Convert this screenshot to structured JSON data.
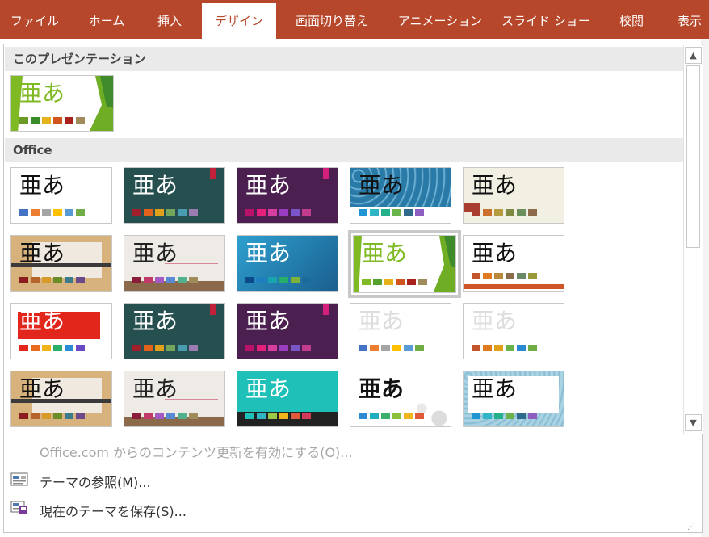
{
  "ribbon": {
    "tabs": [
      {
        "label": "ファイル"
      },
      {
        "label": "ホーム"
      },
      {
        "label": "挿入"
      },
      {
        "label": "デザイン"
      },
      {
        "label": "画面切り替え"
      },
      {
        "label": "アニメーション"
      },
      {
        "label": "スライド ショー"
      },
      {
        "label": "校閲"
      },
      {
        "label": "表示"
      }
    ],
    "active_tab": "デザイン",
    "bar_color": "#b7472a"
  },
  "gallery": {
    "section_this": "このプレゼンテーション",
    "section_office": "Office",
    "current_theme": {
      "text": "亜あ",
      "text_color": "#7fba24",
      "swatches": [
        "#6a9a23",
        "#3a8c2a",
        "#e6b21b",
        "#d1541c",
        "#a8211d",
        "#a08c5a"
      ]
    },
    "themes": [
      {
        "name": "theme-office",
        "text": "亜あ",
        "text_color": "#111111",
        "bg": "#ffffff",
        "swatches": [
          "#4472c4",
          "#ed7d31",
          "#a5a5a5",
          "#ffc000",
          "#5b9bd5",
          "#70ad47"
        ]
      },
      {
        "name": "theme-dark-teal",
        "text": "亜あ",
        "text_color": "#ffffff",
        "bg": "#25504f",
        "swatches": [
          "#a11f2a",
          "#e2621c",
          "#e0a01a",
          "#74a55a",
          "#4a9cb0",
          "#9a7bb2"
        ]
      },
      {
        "name": "theme-purple",
        "text": "亜あ",
        "text_color": "#ffffff",
        "bg": "#4b1f4f",
        "swatches": [
          "#b8126a",
          "#e4207a",
          "#d63fa0",
          "#9b3dc0",
          "#7a55c8",
          "#c23c8e"
        ]
      },
      {
        "name": "theme-blue-pattern",
        "text": "亜あ",
        "text_color": "#111111",
        "bg": "#2a7aa8",
        "swatches": [
          "#1f96d1",
          "#2fb5c4",
          "#23b08a",
          "#6ab24a",
          "#2f6a8a",
          "#8c5fc0"
        ]
      },
      {
        "name": "theme-retrospect",
        "text": "亜あ",
        "text_color": "#111111",
        "bg": "#f1f0e3",
        "swatches": [
          "#a93d30",
          "#c8702c",
          "#b69b40",
          "#7d8a3f",
          "#6a8f5a",
          "#8e6b4a"
        ]
      },
      {
        "name": "theme-wood",
        "text": "亜あ",
        "text_color": "#111111",
        "bg": "#d8b27c",
        "swatches": [
          "#8a1e1e",
          "#b6652a",
          "#d89a2a",
          "#6c8c2a",
          "#3a7a8a",
          "#6a4a8a"
        ]
      },
      {
        "name": "theme-paper",
        "text": "亜あ",
        "text_color": "#222222",
        "bg": "#eeeae6",
        "swatches": [
          "#8b1f3a",
          "#c23a6a",
          "#a35ac2",
          "#5a8ad2",
          "#52b18a",
          "#a08c5a"
        ]
      },
      {
        "name": "theme-ion",
        "text": "亜あ",
        "text_color": "#ffffff",
        "bg": "#2e8dbf",
        "swatches": [
          "#0a4a8a",
          "#1d7fbf",
          "#1aa3b0",
          "#28b06a",
          "#7fb23a",
          "#1a6a9a"
        ]
      },
      {
        "name": "theme-facet",
        "text": "亜あ",
        "text_color": "#7fba24",
        "bg": "#ffffff",
        "swatches": [
          "#7fba24",
          "#52a12d",
          "#e6b21b",
          "#d1541c",
          "#a8211d",
          "#a08c5a"
        ]
      },
      {
        "name": "theme-integral",
        "text": "亜あ",
        "text_color": "#111111",
        "bg": "#ffffff",
        "swatches": [
          "#c2562a",
          "#e07a1f",
          "#b98a3c",
          "#8a6c4a",
          "#6a8a6a",
          "#9a9a3a"
        ]
      },
      {
        "name": "theme-red-banner",
        "text": "亜あ",
        "text_color": "#ffffff",
        "bg": "#ffffff",
        "swatches": [
          "#e3261c",
          "#ea6a1e",
          "#f0b41c",
          "#2bb06a",
          "#2a8ad2",
          "#6a4ac2"
        ]
      },
      {
        "name": "theme-dark-teal-2",
        "text": "亜あ",
        "text_color": "#ffffff",
        "bg": "#25504f",
        "swatches": [
          "#a11f2a",
          "#e2621c",
          "#e0a01a",
          "#74a55a",
          "#4a9cb0",
          "#9a7bb2"
        ]
      },
      {
        "name": "theme-purple-2",
        "text": "亜あ",
        "text_color": "#ffffff",
        "bg": "#4b1f4f",
        "swatches": [
          "#b8126a",
          "#e4207a",
          "#d63fa0",
          "#9b3dc0",
          "#7a55c8",
          "#c23c8e"
        ]
      },
      {
        "name": "theme-light-1",
        "text": "亜あ",
        "text_color": "#dddddd",
        "bg": "#ffffff",
        "swatches": [
          "#4472c4",
          "#ed7d31",
          "#a5a5a5",
          "#ffc000",
          "#5b9bd5",
          "#70ad47"
        ]
      },
      {
        "name": "theme-light-2",
        "text": "亜あ",
        "text_color": "#dddddd",
        "bg": "#ffffff",
        "swatches": [
          "#c2562a",
          "#e07a1f",
          "#e0a01a",
          "#6ab24a",
          "#2a8ad2",
          "#70ad47"
        ]
      },
      {
        "name": "theme-wood-2",
        "text": "亜あ",
        "text_color": "#111111",
        "bg": "#d8b27c",
        "swatches": [
          "#8a1e1e",
          "#b6652a",
          "#d89a2a",
          "#6c8c2a",
          "#3a7a8a",
          "#6a4a8a"
        ]
      },
      {
        "name": "theme-paper-2",
        "text": "亜あ",
        "text_color": "#222222",
        "bg": "#eeeae6",
        "swatches": [
          "#8b1f3a",
          "#c23a6a",
          "#a35ac2",
          "#5a8ad2",
          "#52b18a",
          "#a08c5a"
        ]
      },
      {
        "name": "theme-teal-band",
        "text": "亜あ",
        "text_color": "#ffffff",
        "bg": "#1fc0b8",
        "swatches": [
          "#1fc0b8",
          "#2fb5c4",
          "#9cc84a",
          "#f0b41c",
          "#e05a3a",
          "#d23a5a"
        ]
      },
      {
        "name": "theme-bubbles",
        "text": "亜あ",
        "text_color": "#111111",
        "bg": "#ffffff",
        "swatches": [
          "#2a8ad2",
          "#1fb0c0",
          "#3ab06a",
          "#8cc03a",
          "#f0b41c",
          "#e05a3a"
        ]
      },
      {
        "name": "theme-blue-floral",
        "text": "亜あ",
        "text_color": "#111111",
        "bg": "#8cc0d8",
        "swatches": [
          "#1f96d1",
          "#2fb5c4",
          "#23b08a",
          "#6ab24a",
          "#2f6a8a",
          "#8c5fc0"
        ]
      }
    ],
    "selected_theme": "theme-facet"
  },
  "menu": {
    "update_label": "Office.com からのコンテンツ更新を有効にする(O)...",
    "browse_label": "テーマの参照(M)...",
    "save_label": "現在のテーマを保存(S)..."
  }
}
